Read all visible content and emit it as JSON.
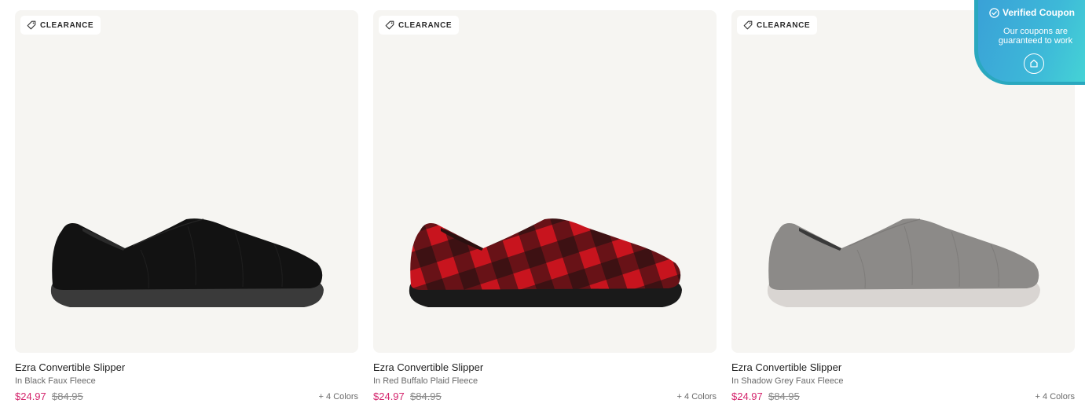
{
  "products": [
    {
      "badge": "CLEARANCE",
      "name": "Ezra Convertible Slipper",
      "variant": "In Black Faux Fleece",
      "sale_price": "$24.97",
      "original_price": "$84.95",
      "colors_more": "+ 4 Colors",
      "upper_color": "#121212",
      "sole_color": "#3a3a3a",
      "pattern": "solid"
    },
    {
      "badge": "CLEARANCE",
      "name": "Ezra Convertible Slipper",
      "variant": "In Red Buffalo Plaid Fleece",
      "sale_price": "$24.97",
      "original_price": "$84.95",
      "colors_more": "+ 4 Colors",
      "upper_color": "#c8141e",
      "sole_color": "#1a1a1a",
      "pattern": "buffalo-plaid"
    },
    {
      "badge": "CLEARANCE",
      "name": "Ezra Convertible Slipper",
      "variant": "In Shadow Grey Faux Fleece",
      "sale_price": "$24.97",
      "original_price": "$84.95",
      "colors_more": "+ 4 Colors",
      "upper_color": "#8c8a88",
      "sole_color": "#d9d5d2",
      "pattern": "solid"
    }
  ],
  "coupon": {
    "title": "Verified Coupon",
    "subtitle": "Our coupons are guaranteed to work"
  },
  "colors": {
    "sale_price": "#d4256d",
    "card_background": "#f6f5f2",
    "coupon_gradient_start": "#3aa1d7",
    "coupon_gradient_end": "#45d3d6"
  }
}
